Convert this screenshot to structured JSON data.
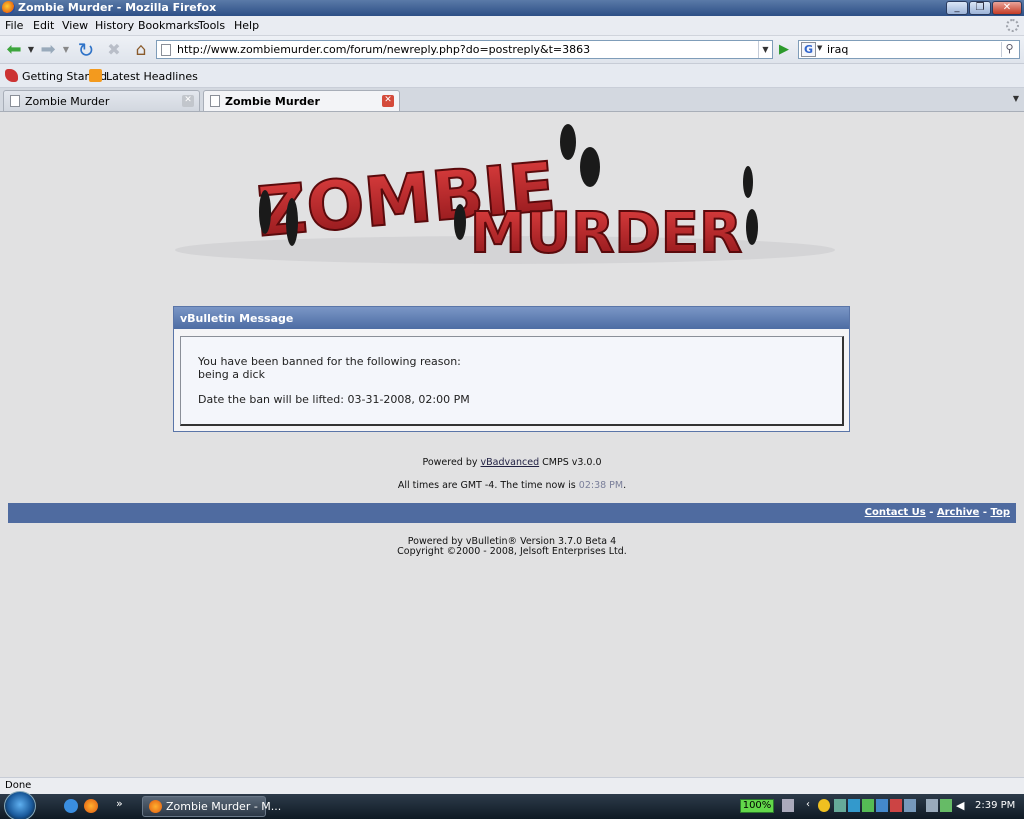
{
  "window": {
    "title": "Zombie Murder - Mozilla Firefox"
  },
  "menu": [
    "File",
    "Edit",
    "View",
    "History",
    "Bookmarks",
    "Tools",
    "Help"
  ],
  "nav": {
    "url": "http://www.zombiemurder.com/forum/newreply.php?do=postreply&t=3863",
    "search_query": "iraq",
    "search_engine_label": "G"
  },
  "bookmarks": [
    "Getting Started",
    "Latest Headlines"
  ],
  "tabs": [
    {
      "label": "Zombie Murder",
      "active": false
    },
    {
      "label": "Zombie Murder",
      "active": true
    }
  ],
  "logo": {
    "line1": "ZOMBIE",
    "line2": "MURDER"
  },
  "message": {
    "header": "vBulletin Message",
    "line1": "You have been banned for the following reason:",
    "line2": "being a dick",
    "line3": "Date the ban will be lifted: 03-31-2008, 02:00 PM"
  },
  "powered": {
    "prefix": "Powered by ",
    "link": "vBadvanced",
    "suffix": " CMPS v3.0.0"
  },
  "times": {
    "prefix": "All times are GMT -4. The time now is ",
    "now": "02:38 PM",
    "suffix": "."
  },
  "footer_links": [
    "Contact Us",
    "Archive",
    "Top"
  ],
  "footer_sep": " - ",
  "copyright": {
    "line1": "Powered by vBulletin® Version 3.7.0 Beta 4",
    "line2": "Copyright ©2000 - 2008, Jelsoft Enterprises Ltd."
  },
  "status": "Done",
  "taskbar": {
    "button": "Zombie Murder - M...",
    "battery": "100%",
    "clock": "2:39 PM",
    "chevron": "»"
  },
  "colors": {
    "page_bg": "#e1e1e2",
    "forum_blue": "#4f6ba0",
    "logo_red": "#c8262a"
  }
}
